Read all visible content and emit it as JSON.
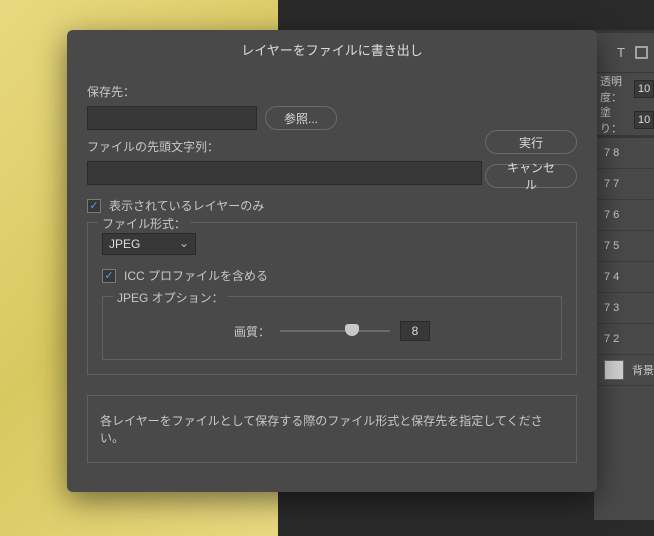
{
  "dialog": {
    "title": "レイヤーをファイルに書き出し",
    "destination_label": "保存先：",
    "destination_value": "",
    "browse_button": "参照...",
    "prefix_label": "ファイルの先頭文字列：",
    "prefix_value": "",
    "run_button": "実行",
    "cancel_button": "キャンセル",
    "visible_only_label": "表示されているレイヤーのみ",
    "visible_only_checked": true,
    "file_format_legend": "ファイル形式：",
    "format_selected": "JPEG",
    "icc_label": "ICC プロファイルを含める",
    "icc_checked": true,
    "jpeg_options_legend": "JPEG オプション：",
    "quality_label": "画質：",
    "quality_value": "8",
    "quality_position_pct": 65,
    "footer_text": "各レイヤーをファイルとして保存する際のファイル形式と保存先を指定してください。"
  },
  "panel": {
    "opacity_label": "透明度：",
    "opacity_value": "10",
    "fill_label": "塗り：",
    "fill_value": "10",
    "layers": [
      "7 8",
      "7 7",
      "7 6",
      "7 5",
      "7 4",
      "7 3",
      "7 2"
    ],
    "bg_layer": "背景"
  }
}
